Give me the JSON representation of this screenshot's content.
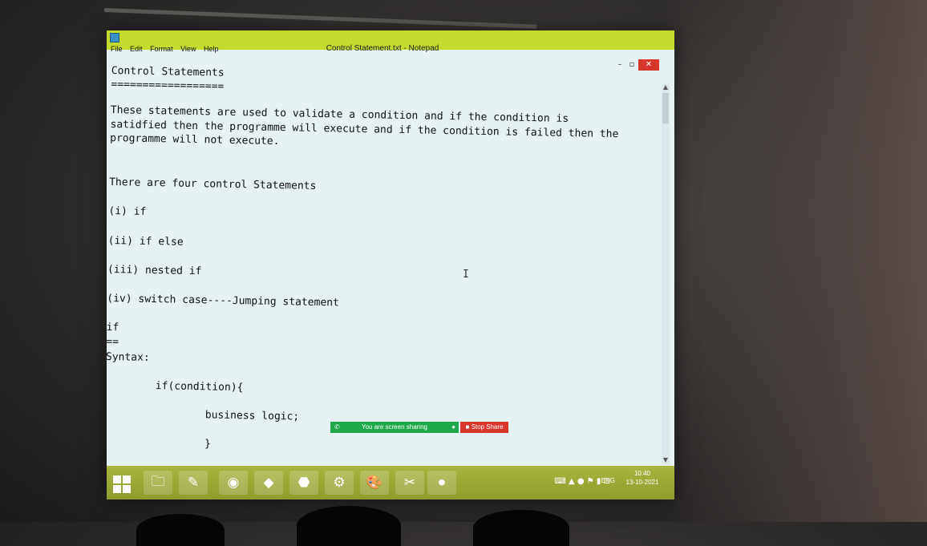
{
  "window": {
    "title": "Control Statement.txt - Notepad",
    "minimize_glyph": "–",
    "maximize_glyph": "▫",
    "close_glyph": "✕"
  },
  "menu": {
    "file": "File",
    "edit": "Edit",
    "format": "Format",
    "view": "View",
    "help": "Help"
  },
  "document": {
    "lines": [
      "Control Statements",
      "==================",
      "These statements are used to validate a condition and if the condition is",
      "satidfied then the programme will execute and if the condition is failed then the",
      "programme will not execute.",
      "There are four control Statements",
      "(i) if",
      "(ii) if else",
      "(iii) nested if",
      "(iv) switch case----Jumping statement",
      "if",
      "==",
      "Syntax:",
      "        if(condition){",
      "                business logic;",
      "                }"
    ]
  },
  "screen_share": {
    "status": "You are screen sharing",
    "stop": "Stop Share"
  },
  "taskbar": {
    "apps": [
      "file-explorer",
      "notepad",
      "chrome",
      "program",
      "acrobat",
      "vlc-like",
      "paint",
      "snipping",
      "zoom"
    ],
    "language": "ENG",
    "time": "10:40",
    "date": "13-10-2021"
  },
  "colors": {
    "accent": "#c4db2c",
    "editor_bg": "#e6f1f4",
    "close_red": "#d9362b",
    "share_green": "#1ea84a"
  }
}
